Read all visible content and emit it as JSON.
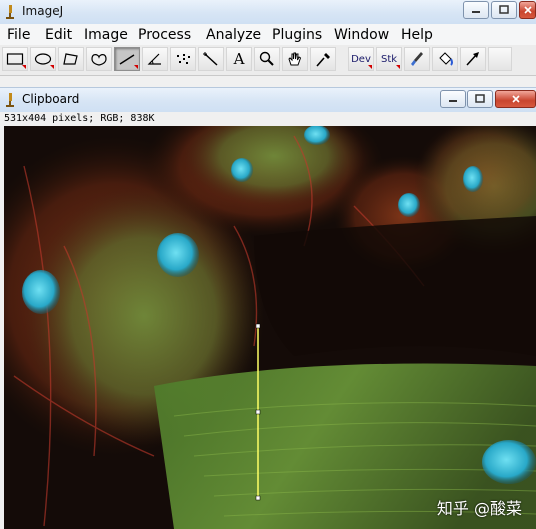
{
  "app": {
    "title": "ImageJ"
  },
  "menu": [
    "File",
    "Edit",
    "Image",
    "Process",
    "Analyze",
    "Plugins",
    "Window",
    "Help"
  ],
  "toolbar": {
    "tools": [
      {
        "name": "rectangle-tool-icon"
      },
      {
        "name": "oval-tool-icon"
      },
      {
        "name": "polygon-tool-icon"
      },
      {
        "name": "freehand-tool-icon"
      },
      {
        "name": "line-tool-icon",
        "selected": true
      },
      {
        "name": "angle-tool-icon"
      },
      {
        "name": "point-tool-icon"
      },
      {
        "name": "wand-tool-icon"
      },
      {
        "name": "text-tool-icon",
        "glyph": "A"
      },
      {
        "name": "magnifier-tool-icon"
      },
      {
        "name": "hand-tool-icon"
      },
      {
        "name": "color-picker-tool-icon"
      }
    ],
    "dev_label": "Dev",
    "stk_label": "Stk",
    "extra_tools": [
      "brush-tool-icon",
      "flood-fill-tool-icon",
      "arrow-tool-icon"
    ]
  },
  "clipboard_window": {
    "title": "Clipboard",
    "info": "531x404 pixels; RGB; 838K"
  },
  "watermark": "知乎 @酸菜",
  "colors": {
    "title_bar": "#d7e5f5",
    "close_button": "#c9452f",
    "selection_line": "#ffff66"
  }
}
